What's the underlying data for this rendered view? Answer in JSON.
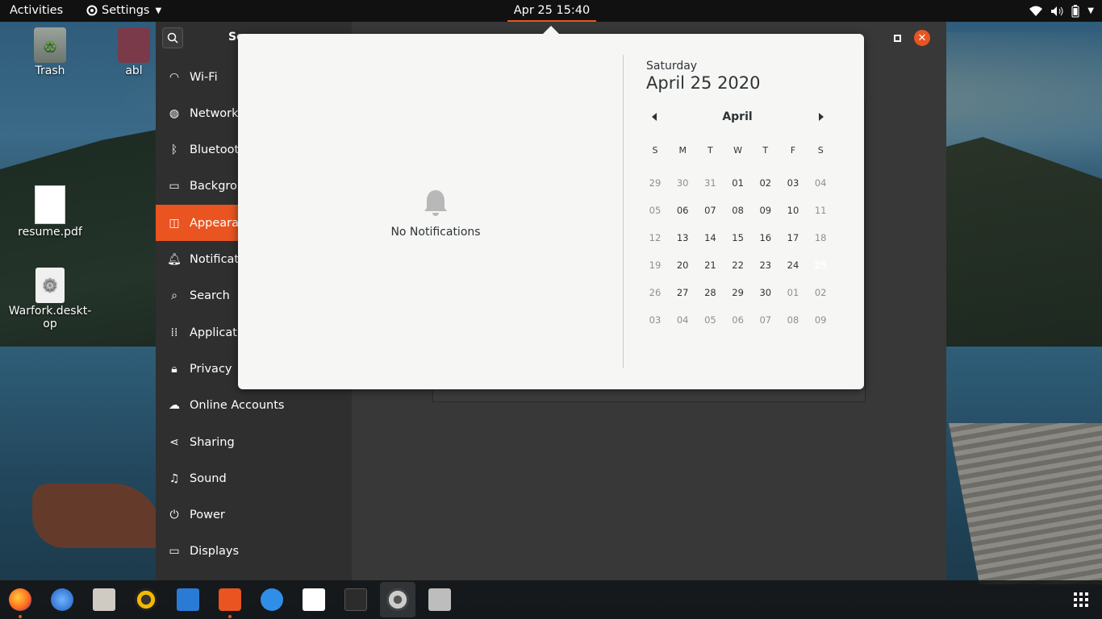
{
  "topbar": {
    "activities": "Activities",
    "app_name": "Settings",
    "clock": "Apr 25  15:40"
  },
  "desktop": {
    "icons": [
      {
        "label": "Trash"
      },
      {
        "label": "abl"
      },
      {
        "label": "resume.pdf"
      },
      {
        "label": "Warfork.deskt-op"
      }
    ]
  },
  "settings": {
    "title": "Se",
    "sidebar": [
      {
        "label": "Wi-Fi",
        "icon": "wifi-icon"
      },
      {
        "label": "Network",
        "icon": "network-icon"
      },
      {
        "label": "Bluetoot",
        "icon": "bluetooth-icon"
      },
      {
        "label": "Backgrou",
        "icon": "background-icon"
      },
      {
        "label": "Appearan",
        "icon": "appearance-icon",
        "active": true
      },
      {
        "label": "Notificat",
        "icon": "bell-icon"
      },
      {
        "label": "Search",
        "icon": "search-icon"
      },
      {
        "label": "Applicati",
        "icon": "apps-icon"
      },
      {
        "label": "Privacy",
        "icon": "lock-icon"
      },
      {
        "label": "Online Accounts",
        "icon": "cloud-icon"
      },
      {
        "label": "Sharing",
        "icon": "share-icon"
      },
      {
        "label": "Sound",
        "icon": "music-note-icon"
      },
      {
        "label": "Power",
        "icon": "power-icon"
      },
      {
        "label": "Displays",
        "icon": "display-icon"
      }
    ],
    "accent": "#e95420"
  },
  "popover": {
    "notifications_empty": "No Notifications",
    "calendar": {
      "weekday": "Saturday",
      "full_date": "April 25 2020",
      "month": "April",
      "day_headers": [
        "S",
        "M",
        "T",
        "W",
        "T",
        "F",
        "S"
      ],
      "weeks": [
        [
          "29",
          "30",
          "31",
          "01",
          "02",
          "03",
          "04"
        ],
        [
          "05",
          "06",
          "07",
          "08",
          "09",
          "10",
          "11"
        ],
        [
          "12",
          "13",
          "14",
          "15",
          "16",
          "17",
          "18"
        ],
        [
          "19",
          "20",
          "21",
          "22",
          "23",
          "24",
          "25"
        ],
        [
          "26",
          "27",
          "28",
          "29",
          "30",
          "01",
          "02"
        ],
        [
          "03",
          "04",
          "05",
          "06",
          "07",
          "08",
          "09"
        ]
      ],
      "today": "25"
    }
  },
  "dock": {
    "apps": [
      "firefox-icon",
      "thunderbird-icon",
      "files-icon",
      "rhythmbox-icon",
      "writer-icon",
      "software-icon",
      "help-icon",
      "amazon-icon",
      "terminal-icon",
      "settings-icon",
      "archive-icon"
    ],
    "show_apps": "show-apps-icon"
  }
}
